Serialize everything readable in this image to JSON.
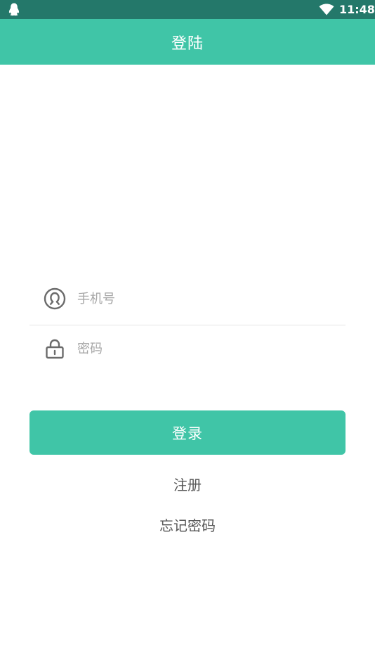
{
  "status_bar": {
    "time": "11:48",
    "icons": [
      "qq-penguin-icon",
      "wifi-icon"
    ]
  },
  "app_bar": {
    "title": "登陆"
  },
  "form": {
    "phone": {
      "icon": "user-circle-icon",
      "placeholder": "手机号",
      "value": ""
    },
    "password": {
      "icon": "lock-icon",
      "placeholder": "密码",
      "value": ""
    }
  },
  "actions": {
    "login_label": "登录",
    "register_label": "注册",
    "forgot_password_label": "忘记密码"
  },
  "colors": {
    "accent": "#40c5a7",
    "status_bar": "#24786a",
    "icon_gray": "#6b6b6b",
    "placeholder": "#a6a6a6"
  }
}
